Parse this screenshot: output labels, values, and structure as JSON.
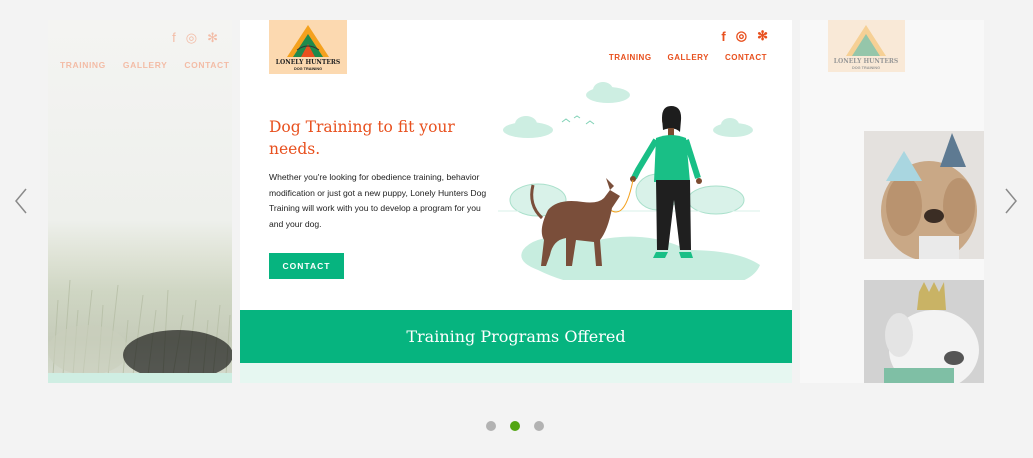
{
  "carousel": {
    "prev_icon": "chevron-left-icon",
    "next_icon": "chevron-right-icon",
    "dots": [
      {
        "label": "slide-1",
        "active": false
      },
      {
        "label": "slide-2",
        "active": true
      },
      {
        "label": "slide-3",
        "active": false
      }
    ]
  },
  "site": {
    "logo_line1": "LONELY HUNTERS",
    "logo_line2": "DOG TRAINING",
    "social": [
      "f",
      "◎",
      "✻"
    ],
    "nav": [
      "TRAINING",
      "GALLERY",
      "CONTACT"
    ],
    "accent_color": "#e8501e",
    "brand_green": "#06b47f"
  },
  "hero": {
    "title": "Dog Training to fit your needs.",
    "body": "Whether you're looking for obedience training, behavior modification or just got a new puppy, Lonely Hunters Dog Training will work with you to develop a program for you and your dog.",
    "cta": "CONTACT"
  },
  "band": {
    "title": "Training Programs Offered"
  }
}
